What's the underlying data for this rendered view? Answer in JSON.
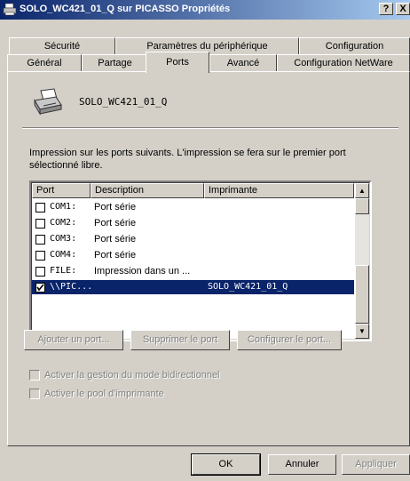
{
  "window": {
    "title": "SOLO_WC421_01_Q sur PICASSO Propriétés",
    "help_glyph": "?",
    "close_glyph": "X"
  },
  "tabs_back": [
    "Sécurité",
    "Paramètres du périphérique",
    "Configuration"
  ],
  "tabs_front": [
    "Général",
    "Partage",
    "Ports",
    "Avancé",
    "Configuration NetWare"
  ],
  "active_tab": "Ports",
  "printer_name": "SOLO_WC421_01_Q",
  "intro_text": "Impression sur les ports suivants. L'impression se fera sur le premier port sélectionné libre.",
  "ports_list": {
    "headers": [
      "Port",
      "Description",
      "Imprimante"
    ],
    "rows": [
      {
        "port": "COM1:",
        "desc": "Port série",
        "printer": "",
        "checked": false,
        "selected": false
      },
      {
        "port": "COM2:",
        "desc": "Port série",
        "printer": "",
        "checked": false,
        "selected": false
      },
      {
        "port": "COM3:",
        "desc": "Port série",
        "printer": "",
        "checked": false,
        "selected": false
      },
      {
        "port": "COM4:",
        "desc": "Port série",
        "printer": "",
        "checked": false,
        "selected": false
      },
      {
        "port": "FILE:",
        "desc": "Impression dans un ...",
        "printer": "",
        "checked": false,
        "selected": false
      },
      {
        "port": "\\\\PIC...",
        "desc": "",
        "printer": "SOLO_WC421_01_Q",
        "checked": true,
        "selected": true
      }
    ],
    "scroll_up_glyph": "▲",
    "scroll_down_glyph": "▼"
  },
  "port_buttons": {
    "add": "Ajouter un port...",
    "delete": "Supprimer le port",
    "configure": "Configurer le port..."
  },
  "options": {
    "bidirectional": "Activer la gestion du mode bidirectionnel",
    "pool": "Activer le pool d'imprimante"
  },
  "dialog_buttons": {
    "ok": "OK",
    "cancel": "Annuler",
    "apply": "Appliquer"
  },
  "colors": {
    "title_start": "#0a246a",
    "title_end": "#a6caf0",
    "face": "#d4d0c8",
    "selection": "#0a246a"
  }
}
